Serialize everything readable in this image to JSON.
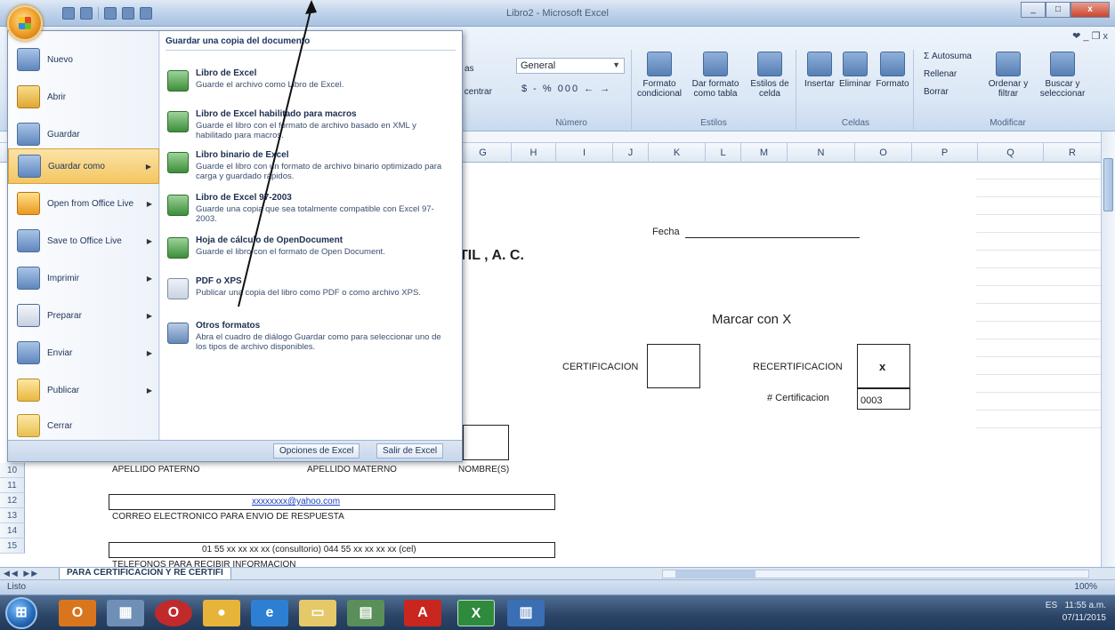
{
  "window": {
    "title": "Libro2 - Microsoft Excel"
  },
  "ribbon": {
    "right_controls": "❤ _ ❐ x",
    "number_format": "General",
    "number_buttons": "$ - % 000 ← →",
    "groups": {
      "numero": "Número",
      "estilos": "Estilos",
      "celdas": "Celdas",
      "modificar": "Modificar"
    },
    "buttons": {
      "formato_condicional": "Formato condicional",
      "dar_formato_tabla": "Dar formato como tabla",
      "estilos_celda": "Estilos de celda",
      "insertar": "Insertar",
      "eliminar": "Eliminar",
      "formato": "Formato",
      "autosuma": "Σ Autosuma",
      "rellenar": "Rellenar",
      "borrar": "Borrar",
      "ordenar_filtrar": "Ordenar y filtrar",
      "buscar_seleccionar": "Buscar y seleccionar",
      "centrar": "y centrar",
      "left_fragment": "as"
    }
  },
  "columns": [
    "G",
    "H",
    "I",
    "J",
    "K",
    "L",
    "M",
    "N",
    "O",
    "P",
    "Q",
    "R"
  ],
  "rows": [
    "10",
    "11",
    "12",
    "13",
    "14",
    "15"
  ],
  "sheet": {
    "fecha_label": "Fecha",
    "til_fragment": "TIL , A. C.",
    "marcar": "Marcar con X",
    "certificacion": "CERTIFICACION",
    "recertificacion": "RECERTIFICACION",
    "x_mark": "x",
    "num_cert_label": "# Certificacion",
    "num_cert_value": "0003",
    "apellido_paterno": "APELLIDO PATERNO",
    "apellido_materno": "APELLIDO MATERNO",
    "nombres": "NOMBRE(S)",
    "email_value": "xxxxxxxx@yahoo.com",
    "email_label": "CORREO ELECTRONICO PARA ENVIO DE RESPUESTA",
    "phone_value": "01 55 xx xx xx xx (consultorio)  044 55 xx xx xx xx (cel)",
    "partial_bottom": "TELEFONOS PARA RECIBIR INFORMACION"
  },
  "office_menu": {
    "items": [
      {
        "label": "Nuevo",
        "arrow": false
      },
      {
        "label": "Abrir",
        "arrow": false
      },
      {
        "label": "Guardar",
        "arrow": false
      },
      {
        "label": "Guardar como",
        "arrow": true
      },
      {
        "label": "Open from Office Live",
        "arrow": true
      },
      {
        "label": "Save to Office Live",
        "arrow": true
      },
      {
        "label": "Imprimir",
        "arrow": true
      },
      {
        "label": "Preparar",
        "arrow": true
      },
      {
        "label": "Enviar",
        "arrow": true
      },
      {
        "label": "Publicar",
        "arrow": true
      },
      {
        "label": "Cerrar",
        "arrow": false
      }
    ],
    "submenu_title": "Guardar una copia del documento",
    "submenu": [
      {
        "title": "Libro de Excel",
        "desc": "Guarde el archivo como Libro de Excel."
      },
      {
        "title": "Libro de Excel habilitado para macros",
        "desc": "Guarde el libro con el formato de archivo basado en XML y habilitado para macros."
      },
      {
        "title": "Libro binario de Excel",
        "desc": "Guarde el libro con un formato de archivo binario optimizado para carga y guardado rápidos."
      },
      {
        "title": "Libro de Excel 97-2003",
        "desc": "Guarde una copia que sea totalmente compatible con Excel 97-2003."
      },
      {
        "title": "Hoja de cálculo de OpenDocument",
        "desc": "Guarde el libro con el formato de Open Document."
      },
      {
        "title": "PDF o XPS",
        "desc": "Publicar una copia del libro como PDF o como archivo XPS."
      },
      {
        "title": "Otros formatos",
        "desc": "Abra el cuadro de diálogo Guardar como para seleccionar uno de los tipos de archivo disponibles."
      }
    ],
    "opciones": "Opciones de Excel",
    "salir": "Salir de Excel"
  },
  "tabs": {
    "sheet_name": "PARA CERTIFICACION Y RE CERTIFI",
    "nav": "◀◀ ▶▶"
  },
  "status": {
    "ready": "Listo",
    "zoom": "100%"
  },
  "tray": {
    "lang": "ES",
    "time": "11:55 a.m.",
    "date": "07/11/2015"
  }
}
